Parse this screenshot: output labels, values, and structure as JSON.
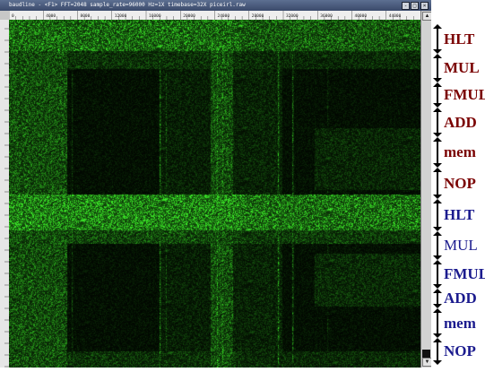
{
  "window": {
    "title": "baudline - <F1> FFT=2048 sample_rate=96000 Hz=1X timebase=32X  piceirl.raw",
    "buttons": [
      "-",
      "□",
      "×"
    ]
  },
  "ruler": {
    "tick_labels": [
      "0",
      "4000",
      "8000",
      "12000",
      "16000",
      "20000",
      "24000",
      "28000",
      "32000",
      "36000",
      "40000",
      "44000"
    ]
  },
  "icons": {
    "up_arrow": "triangle-up-icon",
    "down_arrow": "triangle-down-icon",
    "marker": "double-arrow-icon"
  },
  "colors": {
    "dark_red": "#7a0000",
    "dark_blue": "#1b1b8e",
    "spectrogram_green": "#1fe61f",
    "background": "#000000"
  },
  "instructions": [
    {
      "name": "HLT",
      "color": "#7a0000"
    },
    {
      "name": "MUL",
      "color": "#7a0000"
    },
    {
      "name": "FMUL",
      "color": "#7a0000"
    },
    {
      "name": "ADD",
      "color": "#7a0000"
    },
    {
      "name": "mem",
      "color": "#7a0000"
    },
    {
      "name": "NOP",
      "color": "#7a0000"
    },
    {
      "name": "HLT",
      "color": "#1b1b8e"
    },
    {
      "name": "MUL",
      "color": "#1b1b8e"
    },
    {
      "name": "FMUL",
      "color": "#1b1b8e"
    },
    {
      "name": "ADD",
      "color": "#1b1b8e"
    },
    {
      "name": "mem",
      "color": "#1b1b8e"
    },
    {
      "name": "NOP",
      "color": "#1b1b8e"
    }
  ]
}
